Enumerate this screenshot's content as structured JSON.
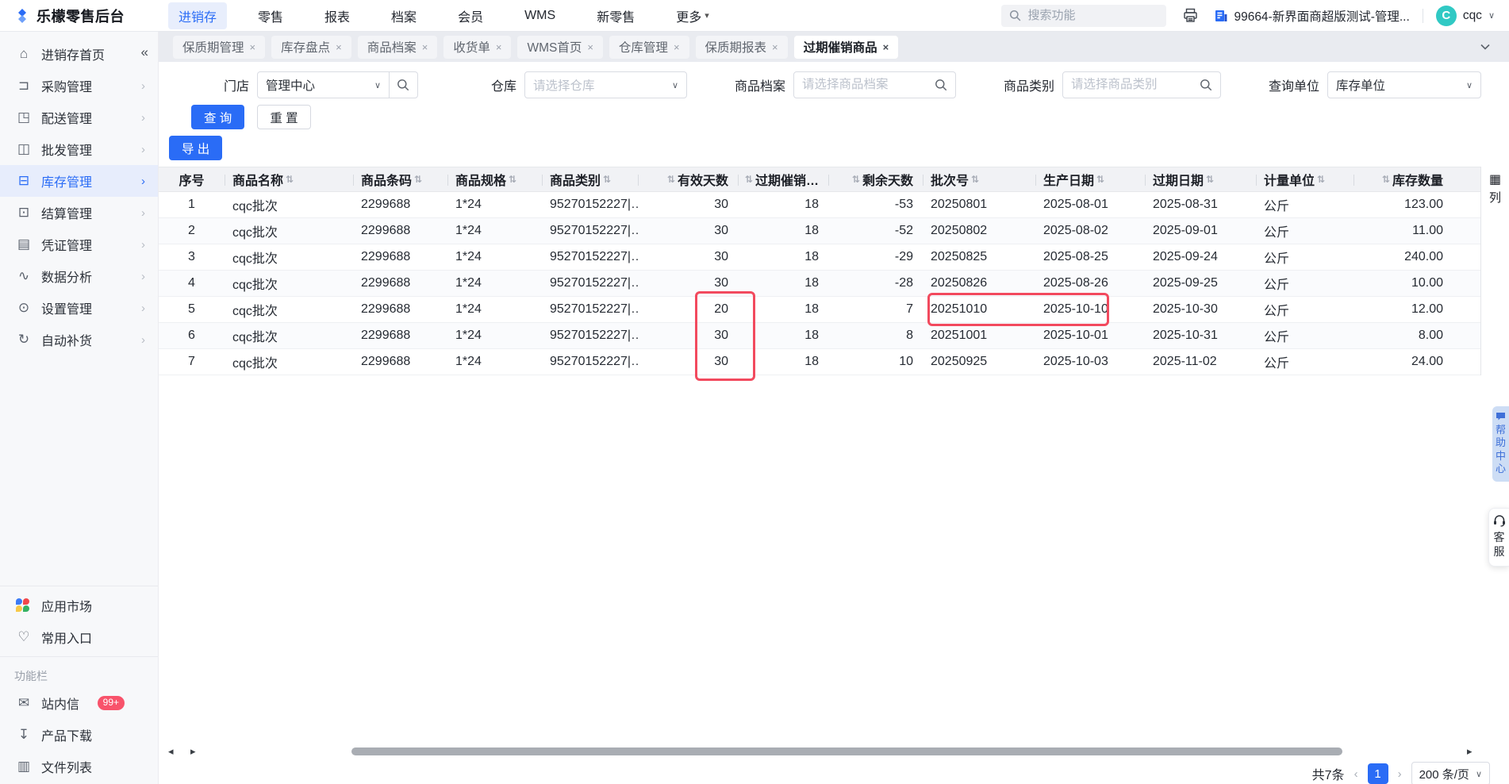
{
  "navbar": {
    "brand": "乐檬零售后台",
    "menu": [
      {
        "name": "nav-item-jinxiaocun",
        "label": "进销存",
        "active": true
      },
      {
        "name": "nav-item-lingshou",
        "label": "零售"
      },
      {
        "name": "nav-item-baobiao",
        "label": "报表"
      },
      {
        "name": "nav-item-dangan",
        "label": "档案"
      },
      {
        "name": "nav-item-huiyuan",
        "label": "会员"
      },
      {
        "name": "nav-item-wms",
        "label": "WMS"
      },
      {
        "name": "nav-item-xinlingshou",
        "label": "新零售"
      },
      {
        "name": "nav-item-more",
        "label": "更多",
        "caret": "▾"
      }
    ],
    "search_placeholder": "搜索功能",
    "org_name": "99664-新界面商超版测试-管理...",
    "avatar_letter": "C",
    "username": "cqc"
  },
  "sidebar": {
    "items": [
      {
        "name": "sidebar-item-home",
        "icon": "home-icon",
        "glyph": "⌂",
        "label": "进销存首页",
        "chev": ""
      },
      {
        "name": "sidebar-item-purchase",
        "icon": "purchase-icon",
        "glyph": "⊐",
        "label": "采购管理",
        "chev": "›"
      },
      {
        "name": "sidebar-item-delivery",
        "icon": "delivery-icon",
        "glyph": "◳",
        "label": "配送管理",
        "chev": "›"
      },
      {
        "name": "sidebar-item-wholesale",
        "icon": "wholesale-icon",
        "glyph": "◫",
        "label": "批发管理",
        "chev": "›"
      },
      {
        "name": "sidebar-item-inventory",
        "icon": "inventory-icon",
        "glyph": "⊟",
        "label": "库存管理",
        "chev": "›",
        "active": true
      },
      {
        "name": "sidebar-item-settlement",
        "icon": "settlement-icon",
        "glyph": "⊡",
        "label": "结算管理",
        "chev": "›"
      },
      {
        "name": "sidebar-item-voucher",
        "icon": "voucher-icon",
        "glyph": "▤",
        "label": "凭证管理",
        "chev": "›"
      },
      {
        "name": "sidebar-item-analytics",
        "icon": "chart-line-icon",
        "glyph": "∿",
        "label": "数据分析",
        "chev": "›"
      },
      {
        "name": "sidebar-item-settings",
        "icon": "gear-icon",
        "glyph": "⊙",
        "label": "设置管理",
        "chev": "›"
      },
      {
        "name": "sidebar-item-replenish",
        "icon": "auto-replenish-icon",
        "glyph": "↻",
        "label": "自动补货",
        "chev": "›"
      }
    ],
    "app_market": "应用市场",
    "favorites": "常用入口",
    "section_label": "功能栏",
    "inbox": "站内信",
    "inbox_badge": "99+",
    "downloads": "产品下载",
    "file_list": "文件列表"
  },
  "tabs": [
    {
      "label": "保质期管理"
    },
    {
      "label": "库存盘点"
    },
    {
      "label": "商品档案"
    },
    {
      "label": "收货单"
    },
    {
      "label": "WMS首页"
    },
    {
      "label": "仓库管理"
    },
    {
      "label": "保质期报表"
    },
    {
      "label": "过期催销商品",
      "active": true
    }
  ],
  "ui": {
    "close_icon": "×",
    "collapse_icon": "«",
    "grid_icon": "▦",
    "left_arrow": "◂",
    "right_arrow": "▸",
    "prev_arrow": "‹",
    "next_arrow": "›"
  },
  "filters": {
    "store": {
      "label": "门店",
      "value": "管理中心"
    },
    "warehouse": {
      "label": "仓库",
      "placeholder": "请选择仓库"
    },
    "product": {
      "label": "商品档案",
      "placeholder": "请选择商品档案"
    },
    "category": {
      "label": "商品类别",
      "placeholder": "请选择商品类别"
    },
    "unit": {
      "label": "查询单位",
      "value": "库存单位"
    }
  },
  "actions": {
    "query": "查 询",
    "reset": "重 置",
    "export": "导 出"
  },
  "table": {
    "columns": [
      {
        "label": "序号",
        "align": "center",
        "sb": "",
        "sa": ""
      },
      {
        "label": "商品名称",
        "align": "left",
        "sb": "",
        "sa": "⇅"
      },
      {
        "label": "商品条码",
        "align": "left",
        "sb": "",
        "sa": "⇅"
      },
      {
        "label": "商品规格",
        "align": "left",
        "sb": "",
        "sa": "⇅"
      },
      {
        "label": "商品类别",
        "align": "left",
        "sb": "",
        "sa": "⇅"
      },
      {
        "label": "有效天数",
        "align": "right",
        "sb": "⇅",
        "sa": ""
      },
      {
        "label": "过期催销…",
        "align": "right",
        "sb": "⇅",
        "sa": ""
      },
      {
        "label": "剩余天数",
        "align": "right",
        "sb": "⇅",
        "sa": ""
      },
      {
        "label": "批次号",
        "align": "left",
        "sb": "",
        "sa": "⇅"
      },
      {
        "label": "生产日期",
        "align": "left",
        "sb": "",
        "sa": "⇅"
      },
      {
        "label": "过期日期",
        "align": "left",
        "sb": "",
        "sa": "⇅"
      },
      {
        "label": "计量单位",
        "align": "left",
        "sb": "",
        "sa": "⇅"
      },
      {
        "label": "库存数量",
        "align": "right",
        "sb": "⇅",
        "sa": ""
      }
    ],
    "rows": [
      {
        "cells": [
          "1",
          "cqc批次",
          "2299688",
          "1*24",
          "95270152227|…",
          "30",
          "18",
          "-53",
          "20250801",
          "2025-08-01",
          "2025-08-31",
          "公斤",
          "123.00"
        ]
      },
      {
        "cells": [
          "2",
          "cqc批次",
          "2299688",
          "1*24",
          "95270152227|…",
          "30",
          "18",
          "-52",
          "20250802",
          "2025-08-02",
          "2025-09-01",
          "公斤",
          "11.00"
        ]
      },
      {
        "cells": [
          "3",
          "cqc批次",
          "2299688",
          "1*24",
          "95270152227|…",
          "30",
          "18",
          "-29",
          "20250825",
          "2025-08-25",
          "2025-09-24",
          "公斤",
          "240.00"
        ]
      },
      {
        "cells": [
          "4",
          "cqc批次",
          "2299688",
          "1*24",
          "95270152227|…",
          "30",
          "18",
          "-28",
          "20250826",
          "2025-08-26",
          "2025-09-25",
          "公斤",
          "10.00"
        ]
      },
      {
        "cells": [
          "5",
          "cqc批次",
          "2299688",
          "1*24",
          "95270152227|…",
          "20",
          "18",
          "7",
          "20251010",
          "2025-10-10",
          "2025-10-30",
          "公斤",
          "12.00"
        ]
      },
      {
        "cells": [
          "6",
          "cqc批次",
          "2299688",
          "1*24",
          "95270152227|…",
          "30",
          "18",
          "8",
          "20251001",
          "2025-10-01",
          "2025-10-31",
          "公斤",
          "8.00"
        ]
      },
      {
        "cells": [
          "7",
          "cqc批次",
          "2299688",
          "1*24",
          "95270152227|…",
          "30",
          "18",
          "10",
          "20250925",
          "2025-10-03",
          "2025-11-02",
          "公斤",
          "24.00"
        ]
      }
    ],
    "column_settings_label": "列"
  },
  "pagination": {
    "total": "共7条",
    "page": "1",
    "page_size": "200 条/页"
  },
  "floating": {
    "help": "帮助中心",
    "service": "客服"
  },
  "colors": {
    "primary": "#2a6cf6",
    "annotation": "#f24a5e",
    "badge": "#f8536b",
    "avatar": "#30c9c4"
  }
}
